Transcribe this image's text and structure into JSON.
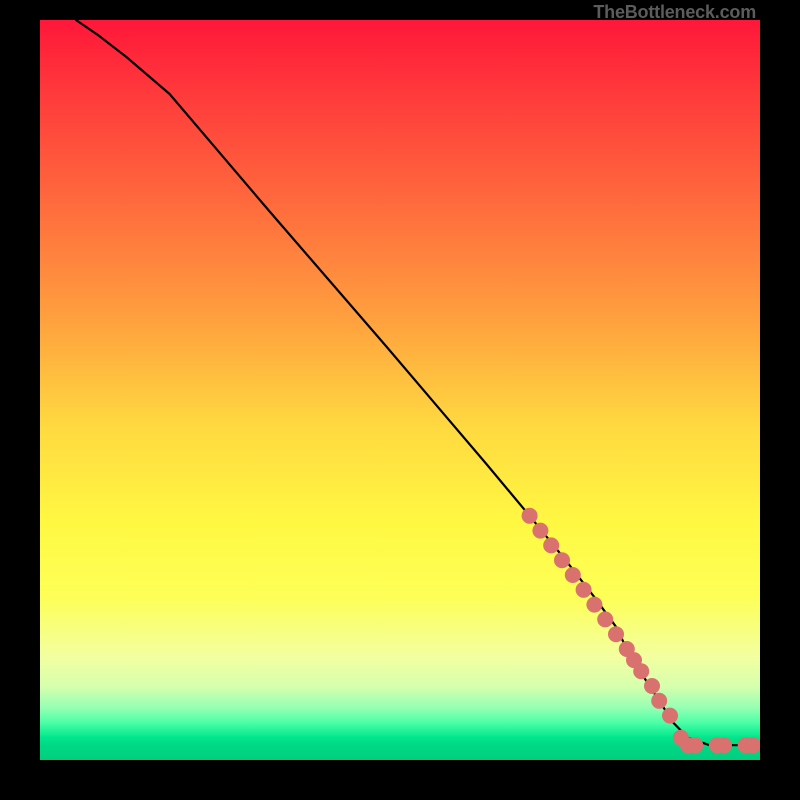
{
  "watermark": "TheBottleneck.com",
  "chart_data": {
    "type": "line",
    "title": "",
    "xlabel": "",
    "ylabel": "",
    "xlim": [
      0,
      100
    ],
    "ylim": [
      0,
      100
    ],
    "background_gradient": {
      "stops": [
        {
          "pos": 0,
          "color": "#ff173a"
        },
        {
          "pos": 10,
          "color": "#ff3a3b"
        },
        {
          "pos": 25,
          "color": "#ff6b3d"
        },
        {
          "pos": 40,
          "color": "#ff9f3e"
        },
        {
          "pos": 55,
          "color": "#ffd940"
        },
        {
          "pos": 68,
          "color": "#fff842"
        },
        {
          "pos": 78,
          "color": "#fdff57"
        },
        {
          "pos": 86,
          "color": "#f3ffa0"
        },
        {
          "pos": 90,
          "color": "#d7ffad"
        },
        {
          "pos": 93,
          "color": "#94ffb3"
        },
        {
          "pos": 95,
          "color": "#4affa6"
        },
        {
          "pos": 97,
          "color": "#00e68c"
        },
        {
          "pos": 98,
          "color": "#00d884"
        },
        {
          "pos": 100,
          "color": "#00cf80"
        }
      ]
    },
    "series": [
      {
        "name": "bottleneck-curve",
        "x": [
          5,
          8,
          12,
          18,
          25,
          32,
          40,
          48,
          55,
          62,
          68,
          73,
          77,
          80,
          82,
          84,
          86,
          88,
          90,
          93,
          96,
          100
        ],
        "y": [
          100,
          98,
          95,
          90,
          82,
          74,
          65,
          56,
          48,
          40,
          33,
          27,
          22,
          18,
          14,
          11,
          8,
          5,
          3,
          2,
          2,
          2
        ]
      }
    ],
    "markers": {
      "name": "highlight-dots",
      "color": "#d9716f",
      "radius_px": 8,
      "points": [
        {
          "x": 68,
          "y": 33
        },
        {
          "x": 69.5,
          "y": 31
        },
        {
          "x": 71,
          "y": 29
        },
        {
          "x": 72.5,
          "y": 27
        },
        {
          "x": 74,
          "y": 25
        },
        {
          "x": 75.5,
          "y": 23
        },
        {
          "x": 77,
          "y": 21
        },
        {
          "x": 78.5,
          "y": 19
        },
        {
          "x": 80,
          "y": 17
        },
        {
          "x": 81.5,
          "y": 15
        },
        {
          "x": 82.5,
          "y": 13.5
        },
        {
          "x": 83.5,
          "y": 12
        },
        {
          "x": 85,
          "y": 10
        },
        {
          "x": 86,
          "y": 8
        },
        {
          "x": 87.5,
          "y": 6
        },
        {
          "x": 89,
          "y": 3
        },
        {
          "x": 90,
          "y": 2
        },
        {
          "x": 91,
          "y": 2
        },
        {
          "x": 94,
          "y": 2
        },
        {
          "x": 95,
          "y": 2
        },
        {
          "x": 98,
          "y": 2
        },
        {
          "x": 99,
          "y": 2
        }
      ]
    }
  }
}
